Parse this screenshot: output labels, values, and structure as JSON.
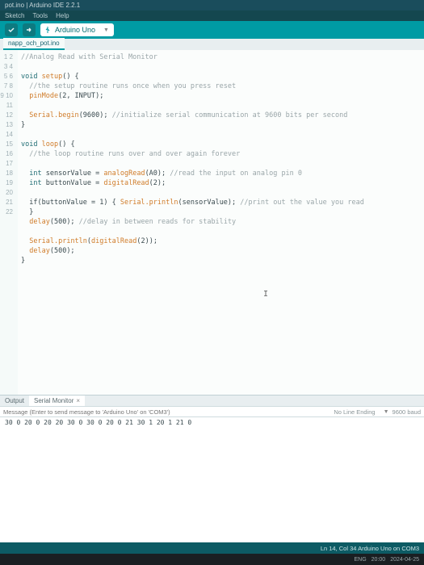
{
  "window": {
    "title": "pot.ino | Arduino IDE 2.2.1"
  },
  "menu": {
    "sketch": "Sketch",
    "tools": "Tools",
    "help": "Help"
  },
  "board": {
    "name": "Arduino Uno"
  },
  "tab": {
    "name": "napp_och_pot.ino"
  },
  "code": {
    "l1_cm": "//Analog Read with Serial Monitor",
    "l3_kw": "void",
    "l3_fn": "setup",
    "l3_tx": "() {",
    "l4_cm": "//the setup routine runs once when you press reset",
    "l5_fn": "pinMode",
    "l5_tx": "(2, INPUT);",
    "l7a": "Serial",
    "l7_fn": ".begin",
    "l7_tx": "(9600);",
    "l7_cm": " //initialize serial communication at 9600 bits per second",
    "l8": "}",
    "l10_kw": "void",
    "l10_fn": "loop",
    "l10_tx": "() {",
    "l11_cm": "//the loop routine runs over and over again forever",
    "l13_ty": "int",
    "l13_nm": " sensorValue = ",
    "l13_fn": "analogRead",
    "l13_tx": "(A0);",
    "l13_cm": " //read the input on analog pin 0",
    "l14_ty": "int",
    "l14_nm": " buttonValue = ",
    "l14_fn": "digitalRead",
    "l14_tx": "(2);",
    "l16_a": "if(buttonValue = 1) { ",
    "l16_b": "Serial",
    "l16_fn": ".println",
    "l16_tx": "(sensorValue);",
    "l16_cm": " //print out the value you read",
    "l17": "}",
    "l18_fn": "delay",
    "l18_tx": "(500);",
    "l18_cm": " //delay in between reads for stability",
    "l20_a": "Serial",
    "l20_fn": ".println",
    "l20_tx": "(",
    "l20_c": "digitalRead",
    "l20_d": "(2));",
    "l21_fn": "delay",
    "l21_tx": "(500);",
    "l22": "}"
  },
  "output": {
    "tab_output": "Output",
    "tab_serial": "Serial Monitor"
  },
  "msgbar": {
    "placeholder": "Message (Enter to send message to 'Arduino Uno' on 'COM3')",
    "lineend": "No Line Ending",
    "baud": "9600 baud"
  },
  "serial_lines": [
    "",
    "30",
    "0",
    "20",
    "0",
    "20",
    "20",
    "30",
    "0",
    "30",
    "",
    "0",
    "20",
    "0",
    "21",
    "30",
    "1",
    "20",
    "1",
    "21",
    "0"
  ],
  "status": {
    "text": "Ln 14, Col 34   Arduino Uno on COM3"
  },
  "tray": {
    "lang": "ENG",
    "time": "20:00",
    "date": "2024-04-25"
  }
}
